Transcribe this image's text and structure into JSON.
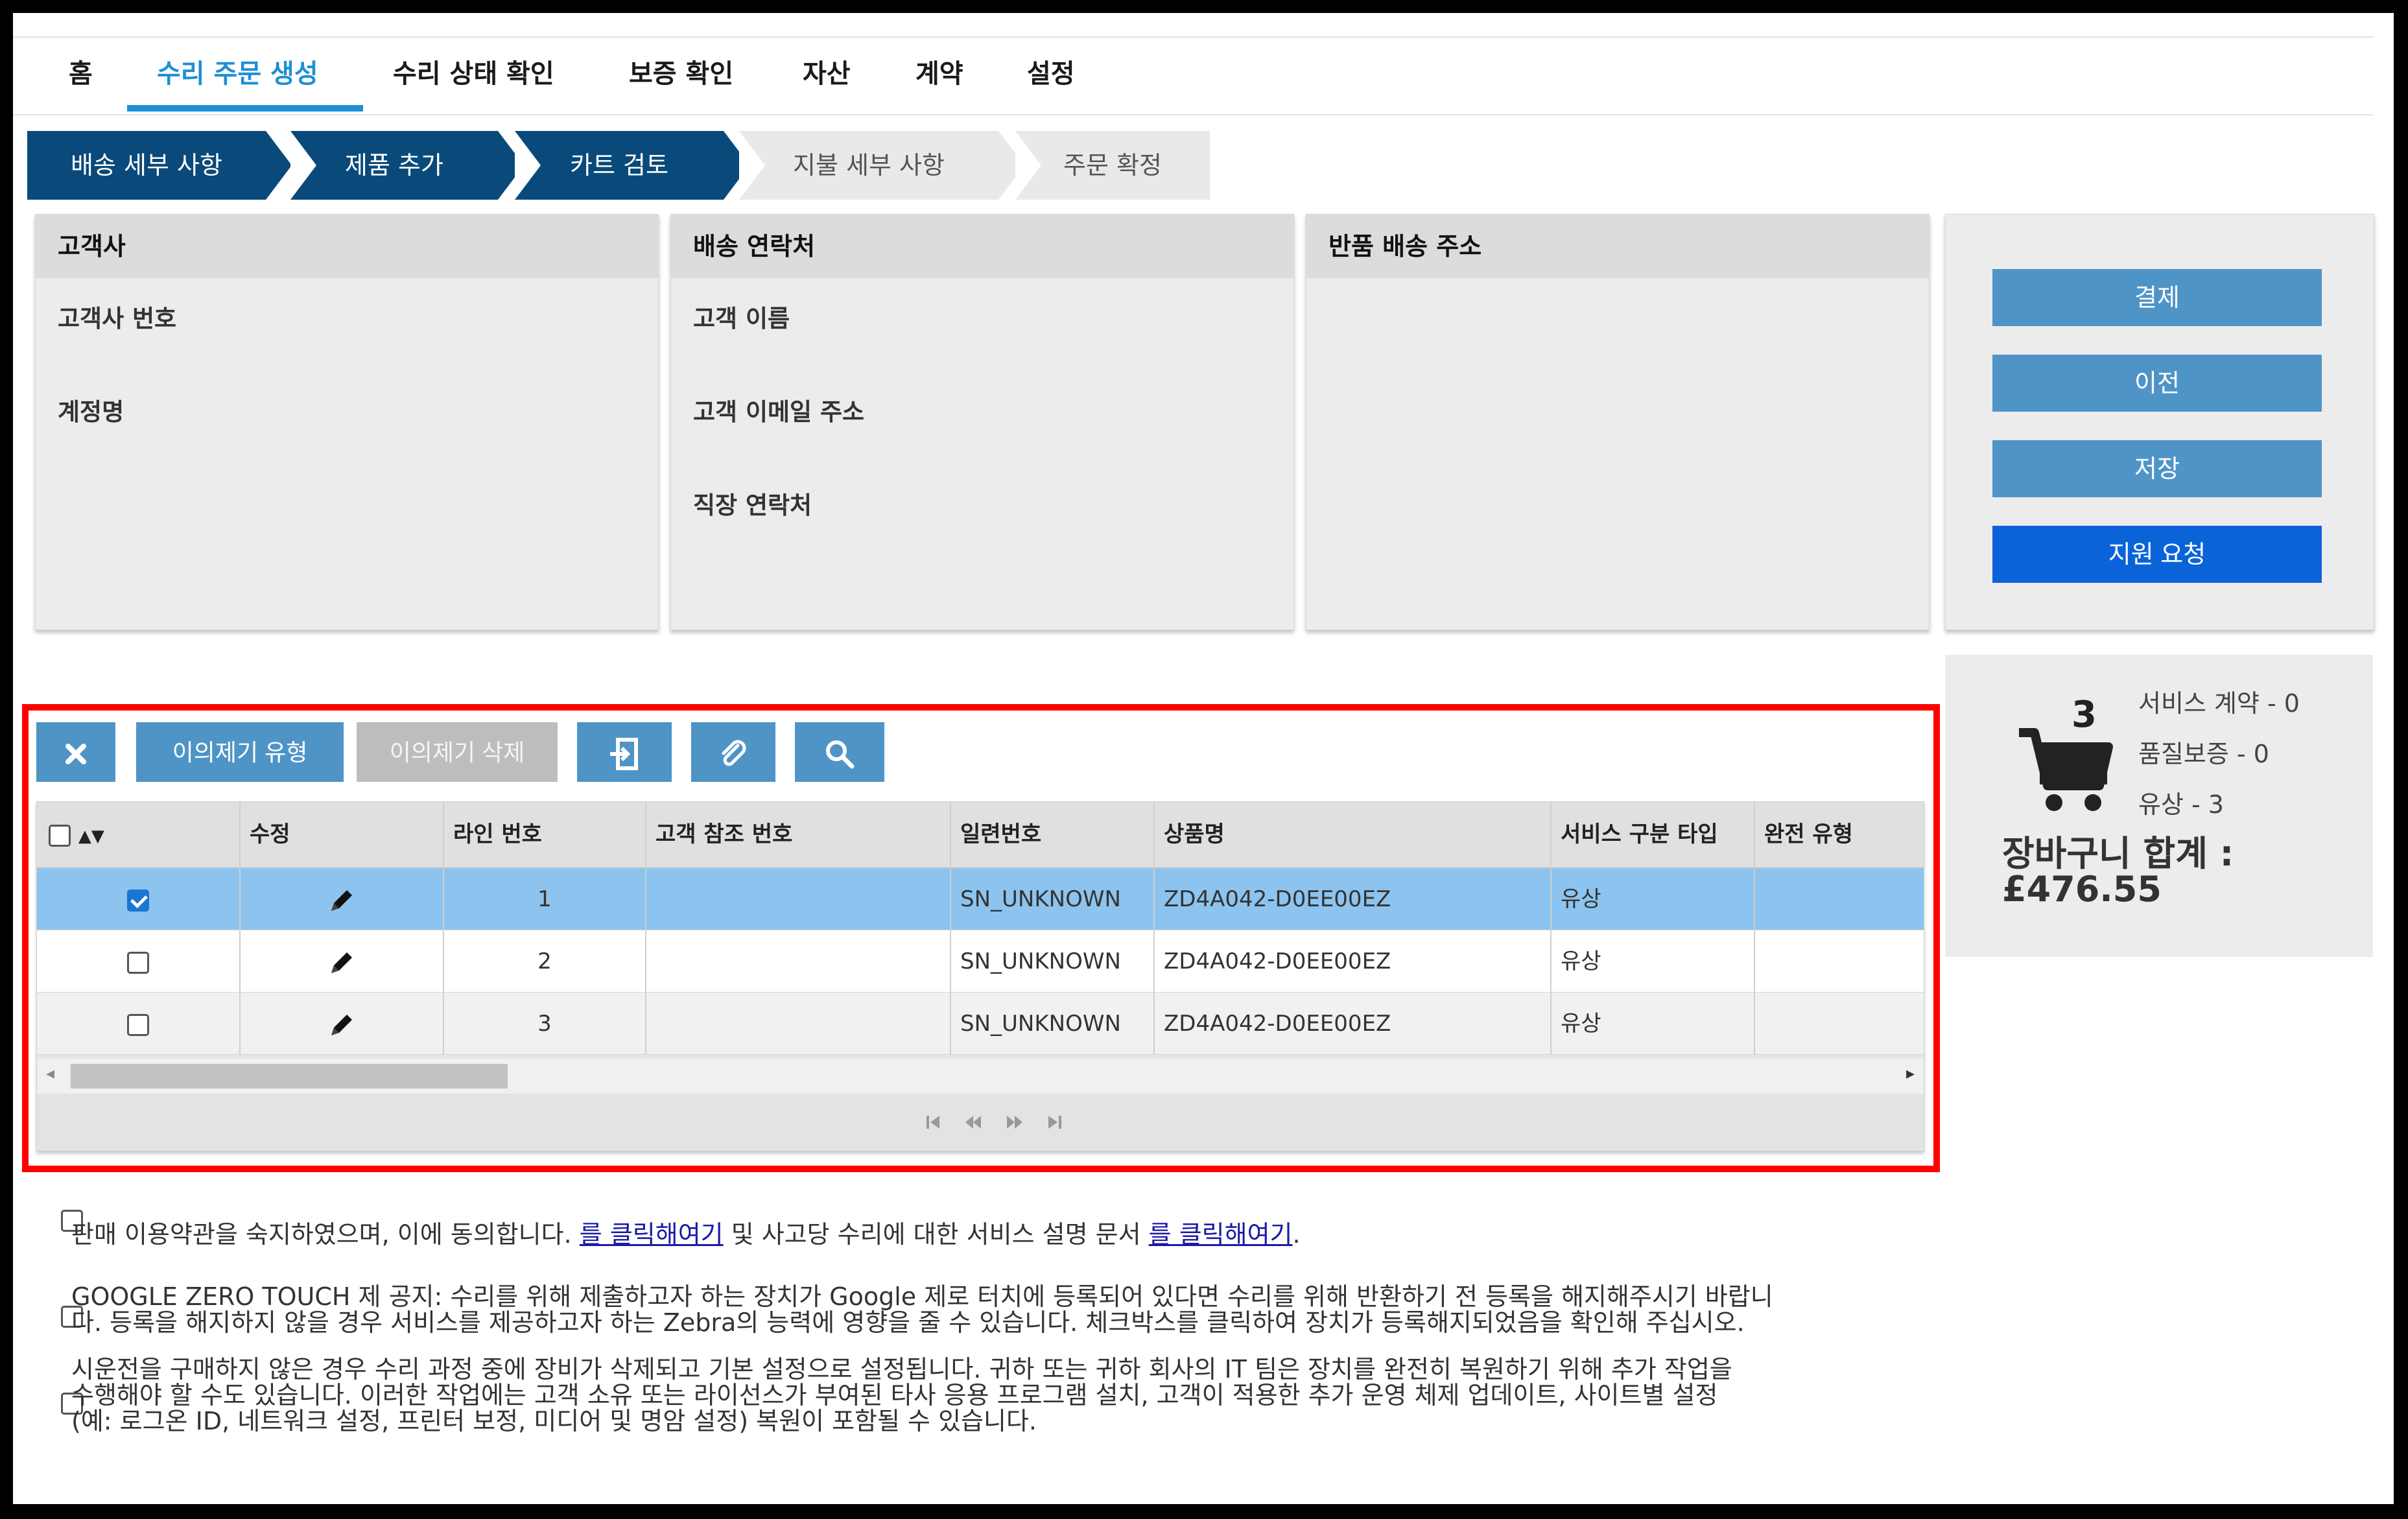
{
  "nav": {
    "items": [
      "홈",
      "수리 주문 생성",
      "수리 상태 확인",
      "보증 확인",
      "자산",
      "계약",
      "설정"
    ],
    "active_index": 1
  },
  "steps": [
    {
      "label": "배송 세부 사항",
      "status": "done"
    },
    {
      "label": "제품 추가",
      "status": "done"
    },
    {
      "label": "카트 검토",
      "status": "done"
    },
    {
      "label": "지불 세부 사항",
      "status": "todo"
    },
    {
      "label": "주문 확정",
      "status": "todo"
    }
  ],
  "panels": {
    "customer": {
      "title": "고객사",
      "rows": [
        "고객사 번호",
        "계정명"
      ]
    },
    "shipping_contact": {
      "title": "배송 연락처",
      "rows": [
        "고객 이름",
        "고객 이메일 주소",
        "직장 연락처"
      ]
    },
    "return_address": {
      "title": "반품 배송 주소"
    }
  },
  "actions": {
    "checkout": "결제",
    "previous": "이전",
    "save": "저장",
    "request_support": "지원 요청"
  },
  "cart": {
    "count": "3",
    "service_contract": "서비스 계약 - 0",
    "warranty": "품질보증 - 0",
    "paid": "유상 - 3",
    "total_label": "장바구니 합계 :",
    "total_value": "£476.55"
  },
  "toolbar": {
    "objection_type": "이의제기 유형",
    "objection_delete": "이의제기 삭제",
    "icons": [
      "close-icon",
      "import-icon",
      "paperclip-icon",
      "search-icon"
    ]
  },
  "grid": {
    "columns": [
      "수정",
      "라인 번호",
      "고객 참조 번호",
      "일련번호",
      "상품명",
      "서비스 구분 타입",
      "완전 유형"
    ],
    "rows": [
      {
        "checked": true,
        "line": "1",
        "ref": "",
        "serial": "SN_UNKNOWN",
        "product": "ZD4A042-D0EE00EZ",
        "service": "유상",
        "type": ""
      },
      {
        "checked": false,
        "line": "2",
        "ref": "",
        "serial": "SN_UNKNOWN",
        "product": "ZD4A042-D0EE00EZ",
        "service": "유상",
        "type": ""
      },
      {
        "checked": false,
        "line": "3",
        "ref": "",
        "serial": "SN_UNKNOWN",
        "product": "ZD4A042-D0EE00EZ",
        "service": "유상",
        "type": ""
      }
    ]
  },
  "terms": {
    "t1_text": "판매 이용약관을 숙지하였으며, 이에 동의합니다.",
    "t1_link1": "를 클릭해여기",
    "t1_mid": "및 사고당 수리에 대한 서비스 설명 문서",
    "t1_link2": "를 클릭해여기",
    "t1_end": ".",
    "t2_line1": "GOOGLE ZERO TOUCH 제 공지: 수리를 위해 제출하고자 하는 장치가 Google 제로 터치에 등록되어 있다면 수리를 위해 반환하기 전 등록을 해지해주시기 바랍니",
    "t2_line2": "다. 등록을 해지하지 않을 경우 서비스를 제공하고자 하는 Zebra의 능력에 영향을 줄 수 있습니다. 체크박스를 클릭하여 장치가 등록해지되었음을 확인해 주십시오.",
    "t3_line1": "시운전을 구매하지 않은 경우 수리 과정 중에 장비가 삭제되고 기본 설정으로 설정됩니다. 귀하 또는 귀하 회사의 IT 팀은 장치를 완전히 복원하기 위해 추가 작업을",
    "t3_line2": "수행해야 할 수도 있습니다. 이러한 작업에는 고객 소유 또는 라이선스가 부여된 타사 응용 프로그램 설치, 고객이 적용한 추가 운영 체제 업데이트, 사이트별 설정",
    "t3_line3": "(예: 로그온 ID, 네트워크 설정, 프린터 보정, 미디어 및 명암 설정) 복원이 포함될 수 있습니다."
  },
  "colors": {
    "accent": "#1d8fd6",
    "step_done": "#0a4a7a",
    "button": "#4f94c7",
    "primary": "#0b63d9",
    "highlight": "#ff0000",
    "selected_row": "#8cc4ef"
  }
}
